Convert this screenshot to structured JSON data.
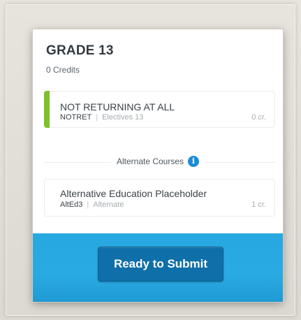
{
  "grade": {
    "title": "GRADE 13",
    "credits": "0 Credits"
  },
  "primary_course": {
    "name": "NOT RETURNING AT ALL",
    "code": "NOTRET",
    "type": "Electives 13",
    "credit": "0 cr.",
    "accent_color": "#7dc12b"
  },
  "alternates": {
    "heading": "Alternate Courses",
    "info_icon": "info-icon",
    "items": [
      {
        "name": "Alternative Education Placeholder",
        "code": "AltEd3",
        "type": "Alternate",
        "credit": "1 cr."
      }
    ]
  },
  "footer": {
    "submit_label": "Ready to Submit",
    "background_color": "#28a8e0",
    "button_color": "#0f6fa8"
  }
}
